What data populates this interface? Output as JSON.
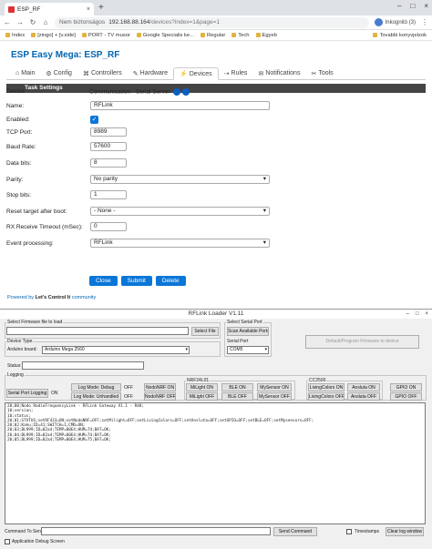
{
  "browser": {
    "tab_title": "ESP_RF",
    "tab_close": "×",
    "new_tab": "+",
    "window_controls": [
      "–",
      "□",
      "×"
    ],
    "nav": {
      "back": "←",
      "forward": "→",
      "reload": "↻",
      "home": "⌂"
    },
    "url_prefix": "Nem biztonságos",
    "url_host": "192.168.88.164",
    "url_path": "/devices?index=1&page=1",
    "profile": "Inkognitó (3)",
    "bookmarks": [
      "Index",
      "[zingo] + [v.side]",
      "PORT - TV musor",
      "Google Specialis ke...",
      "Regular",
      "Tech",
      "Egyeb"
    ],
    "bookmarks_right": "Tovabbi konyvjelzok"
  },
  "esp": {
    "title": "ESP Easy Mega: ESP_RF",
    "menu": [
      {
        "icon": "⌂",
        "label": "Main"
      },
      {
        "icon": "⚙",
        "label": "Config"
      },
      {
        "icon": "⌘",
        "label": "Controllers"
      },
      {
        "icon": "✎",
        "label": "Hardware"
      },
      {
        "icon": "⚡",
        "label": "Devices"
      },
      {
        "icon": "⇢",
        "label": "Rules"
      },
      {
        "icon": "✉",
        "label": "Notifications"
      },
      {
        "icon": "✂",
        "label": "Tools"
      }
    ],
    "section": "Task Settings",
    "device_label": "Device:",
    "device_value": "Communication - Serial Server",
    "name_label": "Name:",
    "name_value": "RFLink",
    "enabled_label": "Enabled:",
    "enabled_check": "✓",
    "tcp_label": "TCP Port:",
    "tcp_value": "8989",
    "baud_label": "Baud Rate:",
    "baud_value": "57600",
    "databits_label": "Data bits:",
    "databits_value": "8",
    "parity_label": "Parity:",
    "parity_value": "No parity",
    "stopbits_label": "Stop bits:",
    "stopbits_value": "1",
    "reset_label": "Reset target after boot:",
    "reset_value": "- None -",
    "timeout_label": "RX Receive Timeout (mSec):",
    "timeout_value": "0",
    "event_label": "Event processing:",
    "event_value": "RFLink",
    "buttons": {
      "close": "Close",
      "submit": "Submit",
      "delete": "Delete"
    },
    "powered_prefix": "Powered by ",
    "powered_brand": "Let's Control It",
    "powered_suffix": " community"
  },
  "loader": {
    "title": "RFLink Loader V1.11",
    "window_controls": [
      "–",
      "□",
      "×"
    ],
    "select_firmware_label": "Select Firmware file to load",
    "select_file_btn": "Select File",
    "device_type_label": "Device Type",
    "arduino_board_label": "Arduino board:",
    "arduino_board_value": "Arduino Mega 2560",
    "select_serial_label": "Select Serial Port",
    "scan_ports_btn": "Scan Available Ports",
    "serial_port_label": "Serial Port",
    "serial_port_value": "COM5",
    "program_btn": "Default/Program Firmware to device",
    "status_label": "Status:",
    "logging_label": "Logging",
    "serial_port_logging_btn": "Serial Port Logging",
    "serial_on": "ON",
    "log_mode_debug_btn": "Log Mode: Debug",
    "log_mode_debug_state": "OFF",
    "log_mode_unhandled_btn": "Log Mode: Unhandled",
    "log_mode_unhandled_state": "OFF",
    "nodonrf_on_btn": "NodoNRF ON",
    "nodonrf_off_btn": "NodoNRF OFF",
    "nrf_label": "NRF24L01",
    "milight_on_btn": "MiLight ON",
    "milight_off_btn": "MiLight OFF",
    "ble_on_btn": "BLE ON",
    "ble_off_btn": "BLE OFF",
    "mysensor_on_btn": "MySensor ON",
    "mysensor_off_btn": "MySensor OFF",
    "cc2500_label": "CC2500",
    "livingcolors_on_btn": "LivingColors ON",
    "livingcolors_off_btn": "LivingColors OFF",
    "ansluta_on_btn": "Ansluta ON",
    "ansluta_off_btn": "Ansluta OFF",
    "gpio_on_btn": "GPIO ON",
    "gpio_off_btn": "GPIO OFF",
    "log_text": "20;00;Nodo RadioFrequencyLink - RFLink Gateway V1.1 - R48;\n10;version;\n10;status;\n20;01;STATUS;setRF433=ON;setNodoNRF=OFF;setMilight=OFF;setLivingColors=OFF;setAnsluta=OFF;setGPIO=OFF;setBLE=OFF;setMysensors=OFF;\n20;02;Kaku;ID=41;SWITCH=1;CMD=ON;\n20;03;BL999;ID=02a4;TEMP=00E4;HUM=74;BAT=OK;\n20;04;BL999;ID=02a4;TEMP=00E4;HUM=74;BAT=OK;\n20;05;BL999;ID=02a4;TEMP=00E4;HUM=75;BAT=OK;",
    "command_label": "Command To Send:",
    "send_btn": "Send Command",
    "timestamps_label": "Timestamps",
    "clear_log_btn": "Clear log window",
    "app_debug_label": "Application Debug Screen"
  }
}
